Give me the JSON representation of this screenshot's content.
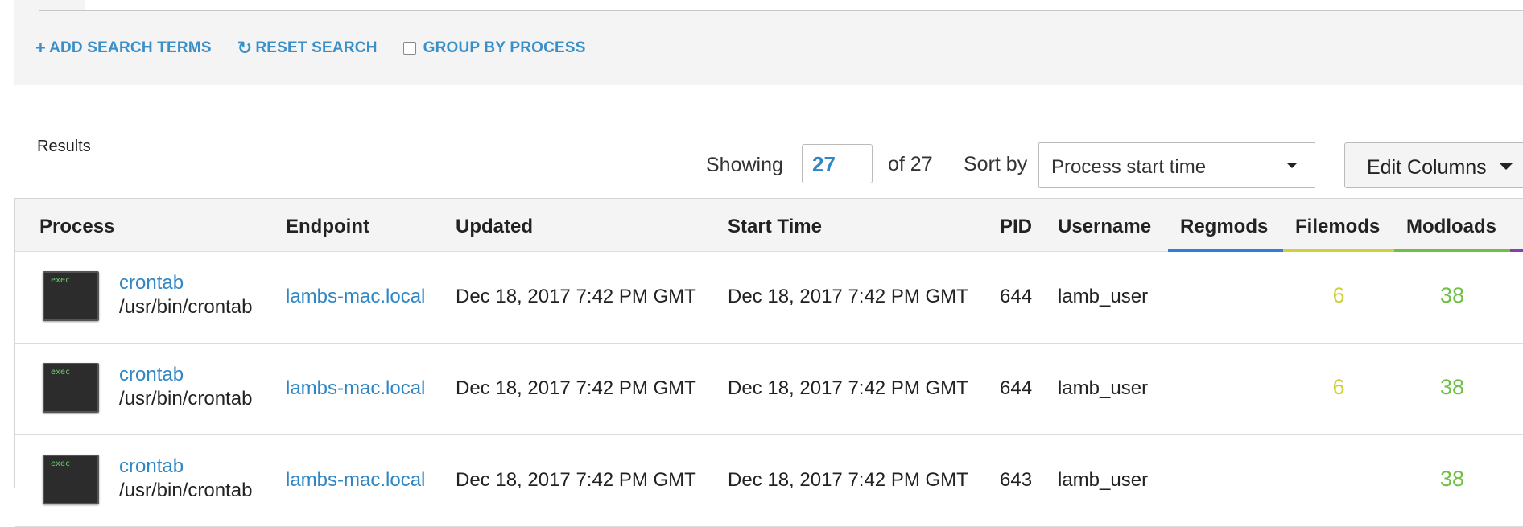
{
  "actions": {
    "add_search_terms": "ADD SEARCH TERMS",
    "reset_search": "RESET SEARCH",
    "group_by_process": "GROUP BY PROCESS",
    "group_by_process_checked": false
  },
  "results": {
    "title": "Results",
    "showing_label": "Showing",
    "showing_value": "27",
    "of_total": "of 27",
    "sort_label": "Sort by",
    "sort_selected": "Process start time",
    "edit_columns": "Edit Columns"
  },
  "columns": {
    "process": "Process",
    "endpoint": "Endpoint",
    "updated": "Updated",
    "start_time": "Start Time",
    "pid": "PID",
    "username": "Username",
    "regmods": "Regmods",
    "filemods": "Filemods",
    "modloads": "Modloads"
  },
  "column_colors": {
    "regmods": "#2d7fd8",
    "filemods": "#cfd13a",
    "modloads": "#6fbf45",
    "next": "#8a3fa8"
  },
  "rows": [
    {
      "thumb_label": "exec",
      "process_name": "crontab",
      "process_path": "/usr/bin/crontab",
      "endpoint": "lambs-mac.local",
      "updated": "Dec 18, 2017 7:42 PM GMT",
      "start_time": "Dec 18, 2017 7:42 PM GMT",
      "pid": "644",
      "username": "lamb_user",
      "regmods": "",
      "filemods": "6",
      "modloads": "38"
    },
    {
      "thumb_label": "exec",
      "process_name": "crontab",
      "process_path": "/usr/bin/crontab",
      "endpoint": "lambs-mac.local",
      "updated": "Dec 18, 2017 7:42 PM GMT",
      "start_time": "Dec 18, 2017 7:42 PM GMT",
      "pid": "644",
      "username": "lamb_user",
      "regmods": "",
      "filemods": "6",
      "modloads": "38"
    },
    {
      "thumb_label": "exec",
      "process_name": "crontab",
      "process_path": "/usr/bin/crontab",
      "endpoint": "lambs-mac.local",
      "updated": "Dec 18, 2017 7:42 PM GMT",
      "start_time": "Dec 18, 2017 7:42 PM GMT",
      "pid": "643",
      "username": "lamb_user",
      "regmods": "",
      "filemods": "",
      "modloads": "38"
    }
  ]
}
